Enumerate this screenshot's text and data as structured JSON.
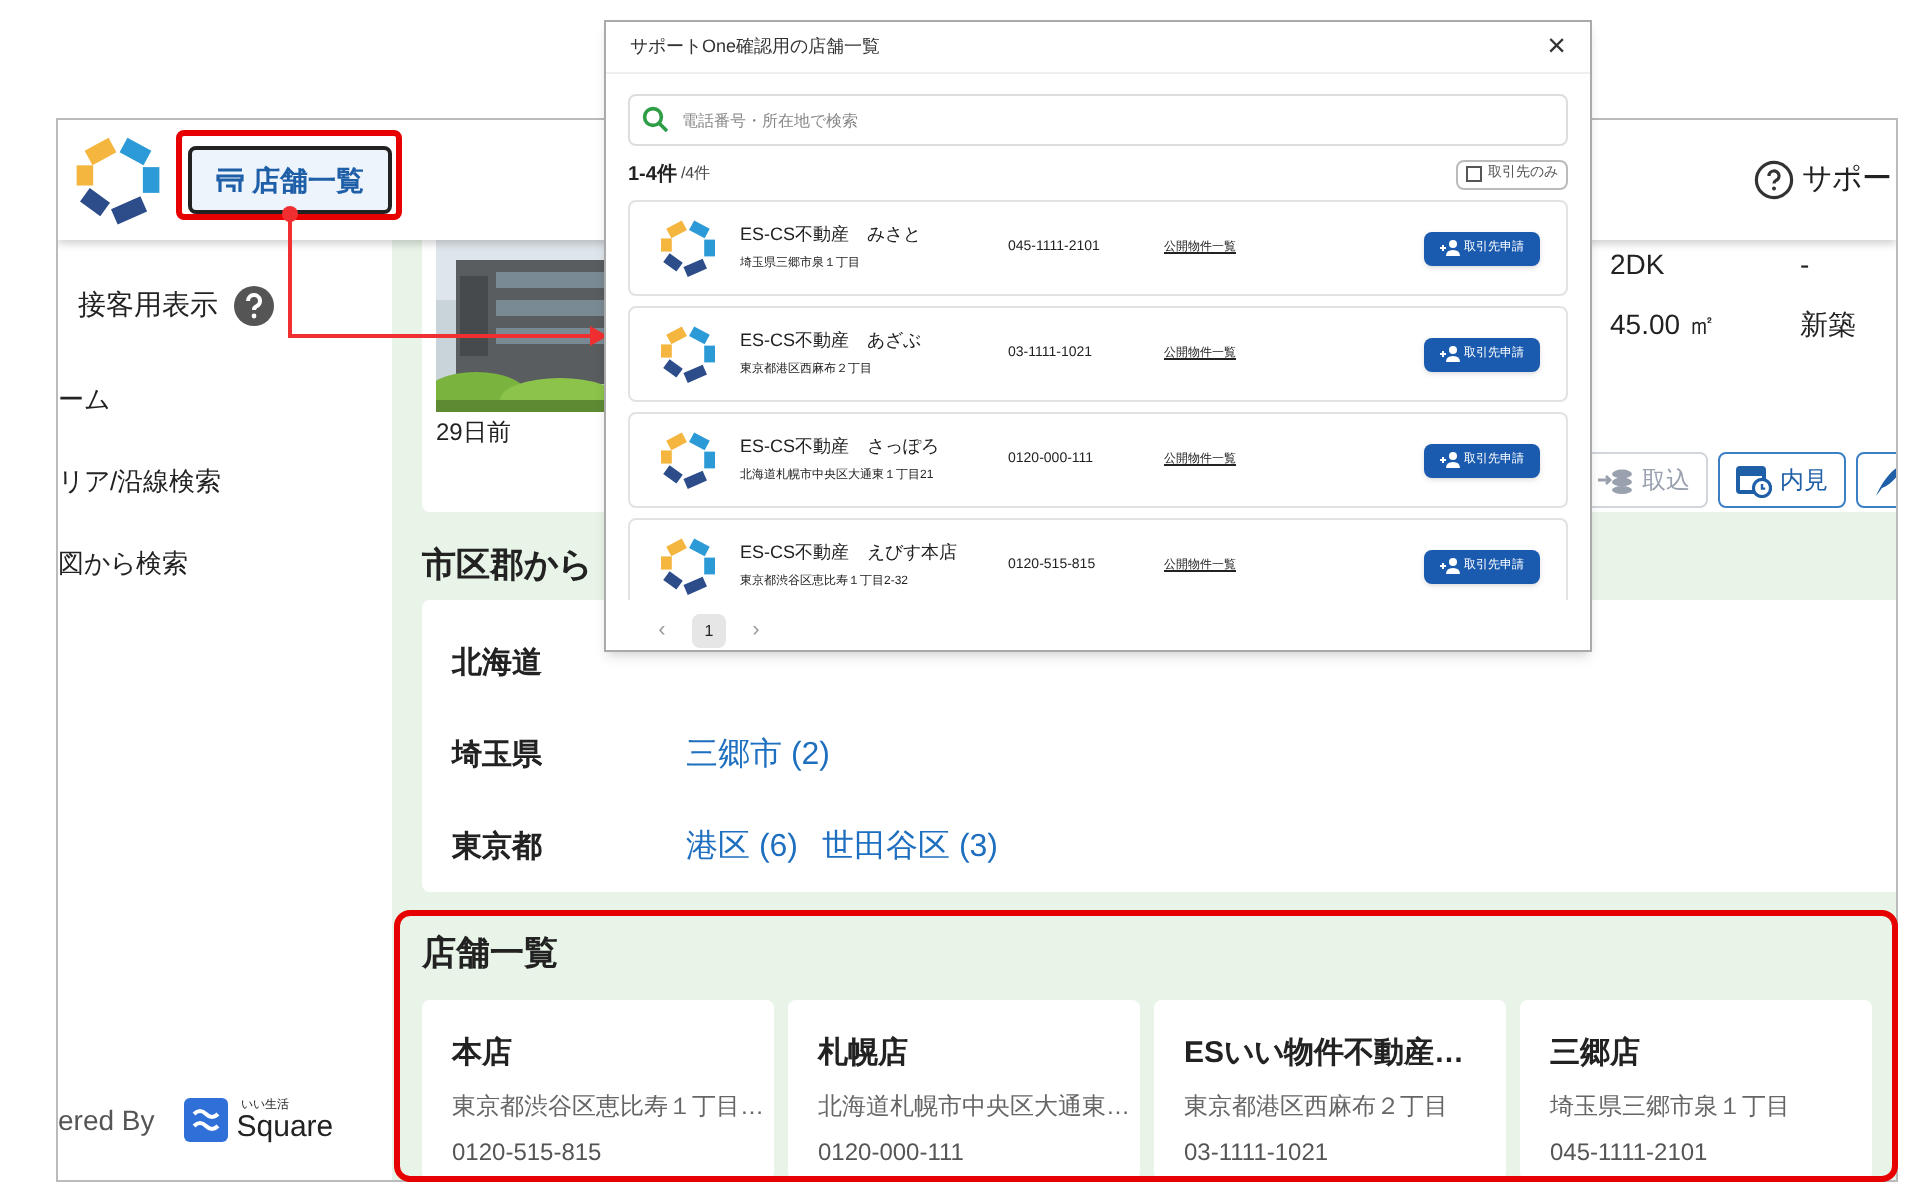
{
  "header": {
    "nav_button": {
      "label": "店舗一覧"
    },
    "support_label": "サポー"
  },
  "sidebar": {
    "display_label": "接客用表示",
    "items": [
      {
        "label": "ーム"
      },
      {
        "label": "リア/沿線検索"
      },
      {
        "label": "図から検索"
      }
    ],
    "footer_text": "ered By",
    "brand_small": "いい生活",
    "brand": "Square"
  },
  "property": {
    "age": "29日前",
    "layout": "2DK",
    "area": "45.00 ㎡",
    "col2_top": "-",
    "col2_bottom": "新築",
    "actions": [
      {
        "label": "取込",
        "disabled": true,
        "kind": "import"
      },
      {
        "label": "内見",
        "disabled": false,
        "kind": "calendar"
      },
      {
        "disabled": false,
        "kind": "pen"
      }
    ]
  },
  "area_search": {
    "title": "市区郡から",
    "prefectures": [
      {
        "name": "北海道"
      },
      {
        "name": "埼玉県",
        "cities": [
          "三郷市 (2)"
        ]
      },
      {
        "name": "東京都",
        "cities": [
          "港区 (6)",
          "世田谷区 (3)"
        ]
      }
    ]
  },
  "store_list": {
    "title": "店舗一覧",
    "stores": [
      {
        "name": "本店",
        "address": "東京都渋谷区恵比寿１丁目…",
        "phone": "0120-515-815"
      },
      {
        "name": "札幌店",
        "address": "北海道札幌市中央区大通東…",
        "phone": "0120-000-111"
      },
      {
        "name": "ESいい物件不動産…",
        "address": "東京都港区西麻布２丁目",
        "phone": "03-1111-1021"
      },
      {
        "name": "三郷店",
        "address": "埼玉県三郷市泉１丁目",
        "phone": "045-1111-2101"
      }
    ]
  },
  "dialog": {
    "title": "サポートOne確認用の店舗一覧",
    "close": "×",
    "search": {
      "placeholder": "電話番号・所在地で検索"
    },
    "count": "1-4件",
    "total": "/4件",
    "filter": {
      "label": "取引先のみ",
      "checked": false
    },
    "rows": [
      {
        "name": "ES-CS不動産　みさと",
        "address": "埼玉県三郷市泉１丁目",
        "phone": "045-1111-2101",
        "link": "公開物件一覧",
        "button": "取引先申請"
      },
      {
        "name": "ES-CS不動産　あざぶ",
        "address": "東京都港区西麻布２丁目",
        "phone": "03-1111-1021",
        "link": "公開物件一覧",
        "button": "取引先申請"
      },
      {
        "name": "ES-CS不動産　さっぽろ",
        "address": "北海道札幌市中央区大通東１丁目21",
        "phone": "0120-000-111",
        "link": "公開物件一覧",
        "button": "取引先申請"
      },
      {
        "name": "ES-CS不動産　えびす本店",
        "address": "東京都渋谷区恵比寿１丁目2-32",
        "phone": "0120-515-815",
        "link": "公開物件一覧",
        "button": "取引先申請"
      }
    ],
    "pagination": {
      "prev": "‹",
      "next": "›",
      "pages": [
        {
          "label": "1",
          "selected": true
        }
      ]
    }
  }
}
